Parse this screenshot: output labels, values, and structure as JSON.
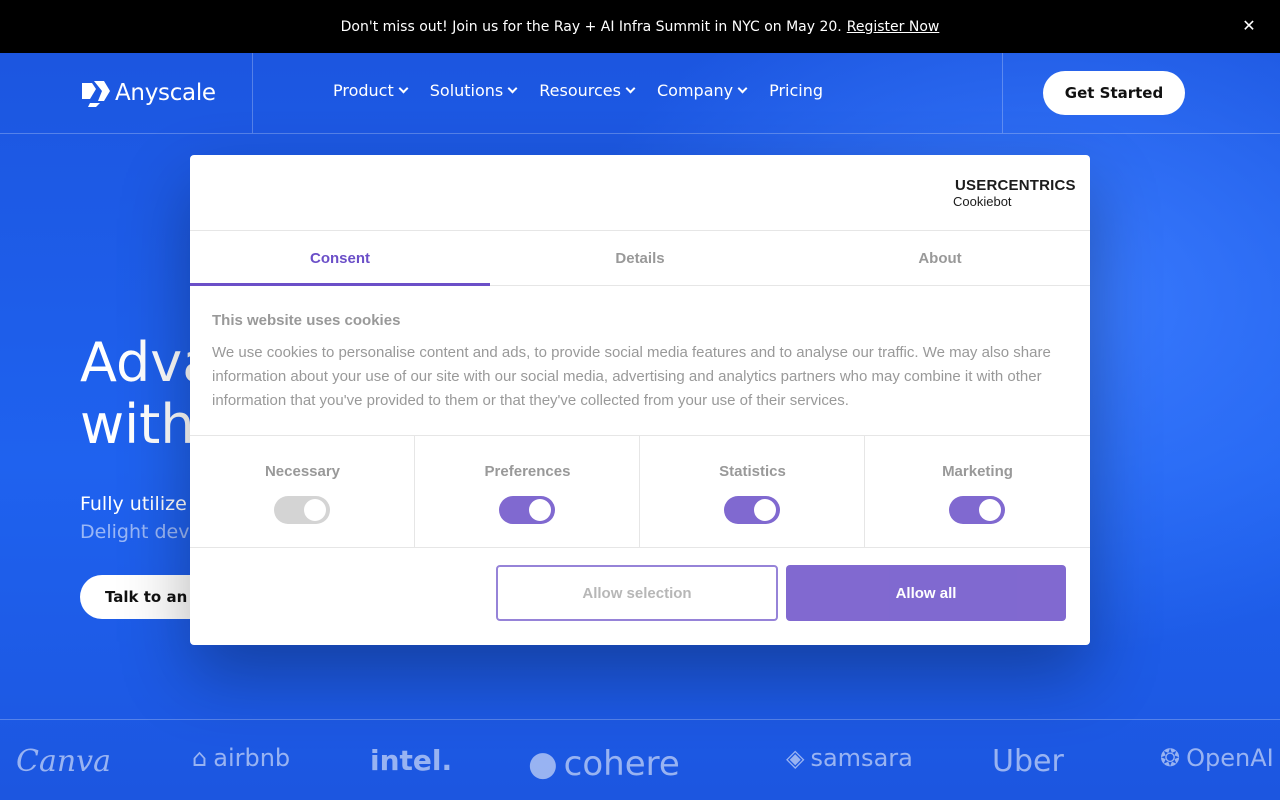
{
  "announcement": {
    "message": "Don't miss out! Join us for the Ray + AI Infra Summit in NYC on May 20.",
    "link": "Register Now",
    "close_icon": "close-icon"
  },
  "nav": {
    "logo_text": "Anyscale",
    "items": [
      {
        "label": "Product",
        "has_dropdown": true
      },
      {
        "label": "Solutions",
        "has_dropdown": true
      },
      {
        "label": "Resources",
        "has_dropdown": true
      },
      {
        "label": "Company",
        "has_dropdown": true
      },
      {
        "label": "Pricing",
        "has_dropdown": false
      }
    ],
    "cta": "Get Started"
  },
  "hero": {
    "title_line1": "Adva",
    "title_line2": "with",
    "sub_line1": "Fully utilize",
    "sub_line2": "Delight dev",
    "button": "Talk to an e"
  },
  "logos": [
    "Canva",
    "airbnb",
    "intel.",
    "cohere",
    "samsara",
    "Uber",
    "OpenAI"
  ],
  "cookie_dialog": {
    "brand_line1": "USERCENTRICS",
    "brand_line2": "Cookiebot",
    "tabs": [
      {
        "label": "Consent",
        "active": true
      },
      {
        "label": "Details",
        "active": false
      },
      {
        "label": "About",
        "active": false
      }
    ],
    "heading": "This website uses cookies",
    "text": "We use cookies to personalise content and ads, to provide social media features and to analyse our traffic. We may also share information about your use of our site with our social media, advertising and analytics partners who may combine it with other information that you've provided to them or that they've collected from your use of their services.",
    "categories": [
      {
        "label": "Necessary",
        "enabled": true,
        "locked": true
      },
      {
        "label": "Preferences",
        "enabled": true,
        "locked": false
      },
      {
        "label": "Statistics",
        "enabled": true,
        "locked": false
      },
      {
        "label": "Marketing",
        "enabled": true,
        "locked": false
      }
    ],
    "allow_selection": "Allow selection",
    "allow_all": "Allow all"
  },
  "colors": {
    "accent": "#6b4fc8",
    "hero_bg": "#1f5ee6"
  }
}
